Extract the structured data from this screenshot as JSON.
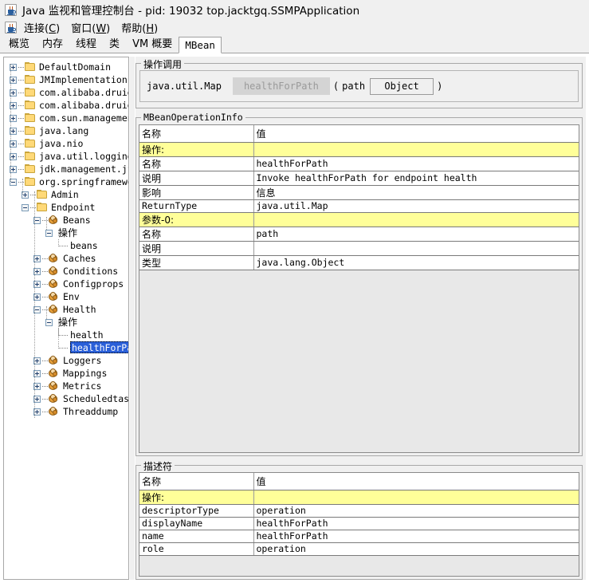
{
  "window": {
    "title": "Java 监视和管理控制台 - pid: 19032 top.jacktgq.SSMPApplication",
    "icon": "java-cup-icon"
  },
  "menubar": {
    "items": [
      {
        "label": "连接(C)",
        "text": "连接(",
        "mnemonic": "C",
        "tail": ")"
      },
      {
        "label": "窗口(W)",
        "text": "窗口(",
        "mnemonic": "W",
        "tail": ")"
      },
      {
        "label": "帮助(H)",
        "text": "帮助(",
        "mnemonic": "H",
        "tail": ")"
      }
    ]
  },
  "tabs": {
    "items": [
      {
        "label": "概览",
        "selected": false
      },
      {
        "label": "内存",
        "selected": false
      },
      {
        "label": "线程",
        "selected": false
      },
      {
        "label": "类",
        "selected": false
      },
      {
        "label": "VM 概要",
        "selected": false
      },
      {
        "label": "MBean",
        "selected": true
      }
    ],
    "selected": "MBean"
  },
  "tree": {
    "nodes": [
      {
        "label": "DefaultDomain",
        "depth": 0,
        "icon": "folder-icon",
        "state": "collapsed"
      },
      {
        "label": "JMImplementation",
        "depth": 0,
        "icon": "folder-icon",
        "state": "collapsed"
      },
      {
        "label": "com.alibaba.druid",
        "depth": 0,
        "icon": "folder-icon",
        "state": "collapsed"
      },
      {
        "label": "com.alibaba.druid.sp",
        "depth": 0,
        "icon": "folder-icon",
        "state": "collapsed"
      },
      {
        "label": "com.sun.management",
        "depth": 0,
        "icon": "folder-icon",
        "state": "collapsed"
      },
      {
        "label": "java.lang",
        "depth": 0,
        "icon": "folder-icon",
        "state": "collapsed"
      },
      {
        "label": "java.nio",
        "depth": 0,
        "icon": "folder-icon",
        "state": "collapsed"
      },
      {
        "label": "java.util.logging",
        "depth": 0,
        "icon": "folder-icon",
        "state": "collapsed"
      },
      {
        "label": "jdk.management.jfr",
        "depth": 0,
        "icon": "folder-icon",
        "state": "collapsed"
      },
      {
        "label": "org.springframework.",
        "depth": 0,
        "icon": "folder-icon",
        "state": "expanded"
      },
      {
        "label": "Admin",
        "depth": 1,
        "icon": "folder-icon",
        "state": "collapsed"
      },
      {
        "label": "Endpoint",
        "depth": 1,
        "icon": "folder-icon",
        "state": "expanded"
      },
      {
        "label": "Beans",
        "depth": 2,
        "icon": "mbean-icon",
        "state": "expanded"
      },
      {
        "label": "操作",
        "depth": 3,
        "icon": "none",
        "state": "expanded",
        "cjk": true
      },
      {
        "label": "beans",
        "depth": 4,
        "icon": "none",
        "state": "leaf"
      },
      {
        "label": "Caches",
        "depth": 2,
        "icon": "mbean-icon",
        "state": "collapsed"
      },
      {
        "label": "Conditions",
        "depth": 2,
        "icon": "mbean-icon",
        "state": "collapsed"
      },
      {
        "label": "Configprops",
        "depth": 2,
        "icon": "mbean-icon",
        "state": "collapsed"
      },
      {
        "label": "Env",
        "depth": 2,
        "icon": "mbean-icon",
        "state": "collapsed"
      },
      {
        "label": "Health",
        "depth": 2,
        "icon": "mbean-icon",
        "state": "expanded"
      },
      {
        "label": "操作",
        "depth": 3,
        "icon": "none",
        "state": "expanded",
        "cjk": true
      },
      {
        "label": "health",
        "depth": 4,
        "icon": "none",
        "state": "leaf"
      },
      {
        "label": "healthForPath",
        "depth": 4,
        "icon": "none",
        "state": "leaf",
        "selected": true
      },
      {
        "label": "Loggers",
        "depth": 2,
        "icon": "mbean-icon",
        "state": "collapsed"
      },
      {
        "label": "Mappings",
        "depth": 2,
        "icon": "mbean-icon",
        "state": "collapsed"
      },
      {
        "label": "Metrics",
        "depth": 2,
        "icon": "mbean-icon",
        "state": "collapsed"
      },
      {
        "label": "Scheduledtasks",
        "depth": 2,
        "icon": "mbean-icon",
        "state": "collapsed"
      },
      {
        "label": "Threaddump",
        "depth": 2,
        "icon": "mbean-icon",
        "state": "collapsed"
      }
    ],
    "selected_node": "healthForPath"
  },
  "operation_invocation": {
    "group_label": "操作调用",
    "return_type": "java.util.Map",
    "button_label": "healthForPath",
    "button_enabled": false,
    "open_paren": "(",
    "close_paren": ")",
    "parameters": [
      {
        "name": "path",
        "value": "Object"
      }
    ]
  },
  "operation_info": {
    "group_label": "MBeanOperationInfo",
    "columns": [
      "名称",
      "值"
    ],
    "rows": [
      {
        "name": "操作:",
        "value": "",
        "section": true,
        "cjk": true
      },
      {
        "name": "名称",
        "value": "healthForPath",
        "section": false,
        "cjk": true
      },
      {
        "name": "说明",
        "value": "Invoke healthForPath for endpoint health",
        "section": false,
        "cjk": true
      },
      {
        "name": "影响",
        "value": "信息",
        "section": false,
        "cjk": true,
        "value_cjk": true
      },
      {
        "name": "ReturnType",
        "value": "java.util.Map",
        "section": false,
        "cjk": false
      },
      {
        "name": "参数-0:",
        "value": "",
        "section": true,
        "cjk": true
      },
      {
        "name": "名称",
        "value": "path",
        "section": false,
        "cjk": true
      },
      {
        "name": "说明",
        "value": "",
        "section": false,
        "cjk": true
      },
      {
        "name": "类型",
        "value": "java.lang.Object",
        "section": false,
        "cjk": true
      }
    ]
  },
  "descriptor": {
    "group_label": "描述符",
    "columns": [
      "名称",
      "值"
    ],
    "rows": [
      {
        "name": "操作:",
        "value": "",
        "section": true,
        "cjk": true
      },
      {
        "name": "descriptorType",
        "value": "operation",
        "section": false,
        "cjk": false
      },
      {
        "name": "displayName",
        "value": "healthForPath",
        "section": false,
        "cjk": false
      },
      {
        "name": "name",
        "value": "healthForPath",
        "section": false,
        "cjk": false
      },
      {
        "name": "role",
        "value": "operation",
        "section": false,
        "cjk": false
      }
    ]
  },
  "colors": {
    "section_highlight": "#ffff99",
    "selection_blue": "#2a5fd8",
    "panel_bg": "#f0f0f0",
    "table_bg": "#ffffff",
    "table_filler": "#e8e8e8",
    "border": "#a8a8a8",
    "folder_icon": "#ffd978",
    "mbean_icon": "#e8a13c"
  }
}
